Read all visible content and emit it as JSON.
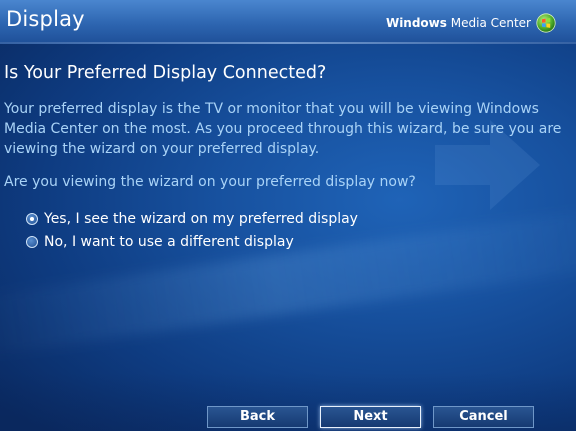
{
  "window": {
    "title": "Display",
    "brand_prefix": "Windows",
    "brand_suffix": "Media Center"
  },
  "content": {
    "heading": "Is Your Preferred Display Connected?",
    "intro": "Your preferred display is the TV or monitor that you will be viewing Windows Media Center on the most. As you proceed through this wizard, be sure you are viewing the wizard on your preferred display.",
    "question": "Are you viewing the wizard on your preferred display now?",
    "options": [
      {
        "label": "Yes, I see the wizard on my preferred display",
        "selected": true
      },
      {
        "label": "No, I want to use a different display",
        "selected": false
      }
    ]
  },
  "buttons": {
    "back": "Back",
    "next": "Next",
    "cancel": "Cancel"
  },
  "colors": {
    "background": "#17519f",
    "body_text": "#a9d3f7",
    "heading_text": "#ffffff"
  },
  "icons": {
    "logo": "windows-media-center-logo-icon",
    "background_arrow": "arrow-right-icon"
  }
}
